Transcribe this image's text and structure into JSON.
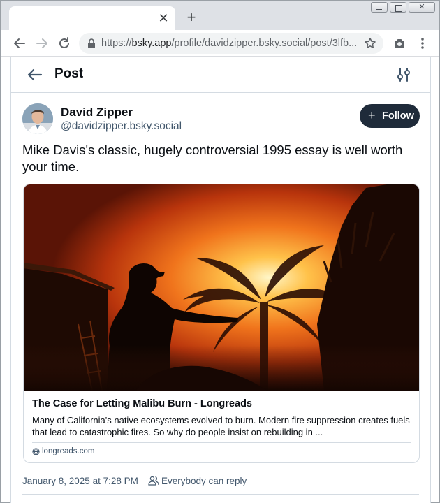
{
  "browser": {
    "tab": {
      "close_glyph": "✕"
    },
    "new_tab_glyph": "+",
    "url": {
      "scheme": "https://",
      "host": "bsky.app",
      "path": "/profile/davidzipper.bsky.social/post/3lfb..."
    }
  },
  "header": {
    "title": "Post"
  },
  "author": {
    "name": "David Zipper",
    "handle": "@davidzipper.bsky.social",
    "follow_label": "Follow"
  },
  "post": {
    "text": "Mike Davis's classic, hugely controversial 1995 essay is well worth your time."
  },
  "embed": {
    "title": "The Case for Letting Malibu Burn - Longreads",
    "description": "Many of California's native ecosystems evolved to burn. Modern fire suppression creates fuels that lead to catastrophic fires. So why do people insist on rebuilding in ...",
    "domain": "longreads.com"
  },
  "meta": {
    "timestamp": "January 8, 2025 at 7:28 PM",
    "reply_setting": "Everybody can reply"
  },
  "colors": {
    "follow_bg": "#1f2b3a",
    "muted_text": "#42576c",
    "border": "#d4dbe2"
  },
  "icons": [
    "back-arrow-icon",
    "forward-arrow-icon",
    "reload-icon",
    "lock-icon",
    "star-icon",
    "camera-icon",
    "kebab-menu-icon",
    "filter-sliders-icon",
    "plus-icon",
    "globe-icon",
    "people-icon"
  ]
}
